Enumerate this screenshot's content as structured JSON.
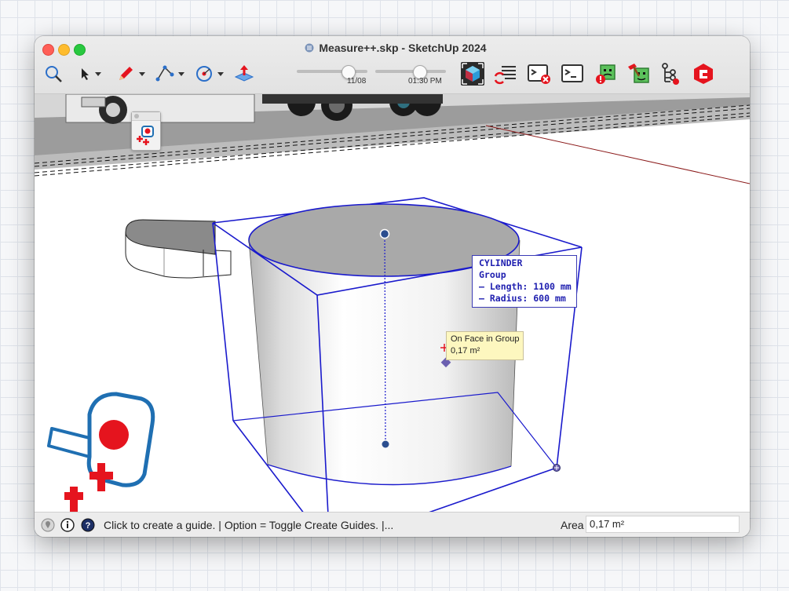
{
  "window": {
    "title": "Measure++.skp - SketchUp 2024"
  },
  "toolbar": {
    "tools": [
      "search-icon",
      "select-arrow-icon",
      "pencil-icon",
      "arc-icon",
      "tape-circle-icon",
      "push-pull-icon"
    ],
    "date_slider": {
      "label": "11/08",
      "value": 0.77
    },
    "time_slider": {
      "label": "01:30 PM",
      "value": 0.65
    },
    "extension_icons": [
      "cube-select-icon",
      "reload-lines-icon",
      "console-close-icon",
      "console-icon",
      "warning-face-icon",
      "hammer-face-icon",
      "tree-icon",
      "ruby-gem-icon"
    ]
  },
  "viewport": {
    "info_box": {
      "lines": [
        "CYLINDER",
        "Group",
        "– Length: 1100 mm",
        "– Radius: 600 mm"
      ]
    },
    "tooltip": {
      "lines": [
        "On Face in Group",
        "0,17 m²"
      ]
    }
  },
  "status": {
    "hint": "Click to create a guide. | Option = Toggle Create Guides. |...",
    "area_label": "Area",
    "area_value": "0,17 m²"
  },
  "colors": {
    "bbox_blue": "#1a1acc",
    "tooltip_bg": "#fdf7bf",
    "logo_red": "#e5141e",
    "logo_blue": "#1f6fb2"
  }
}
